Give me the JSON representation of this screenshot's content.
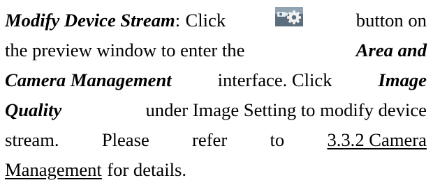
{
  "paragraph": {
    "l1": {
      "term": "Modify Device Stream",
      "colon": ":",
      "click": "Click",
      "button_icon": "camera-gear-icon",
      "after_icon": "button on"
    },
    "l2": {
      "text": "the preview window to enter the",
      "emph": "Area and"
    },
    "l3": {
      "emph": "Camera Management",
      "text": "interface. Click",
      "emph2": "Image"
    },
    "l4": {
      "emph": "Quality",
      "text": "under Image Setting to modify device"
    },
    "l5": {
      "w1": "stream.",
      "w2": "Please",
      "w3": "refer",
      "w4": "to",
      "link_part": "3.3.2 Camera"
    },
    "l6": {
      "link_part": "Management",
      "text": "for details."
    }
  },
  "colors": {
    "text": "#000000",
    "icon_bg": "#5a6e7e",
    "icon_gear": "#f2f2f2"
  }
}
